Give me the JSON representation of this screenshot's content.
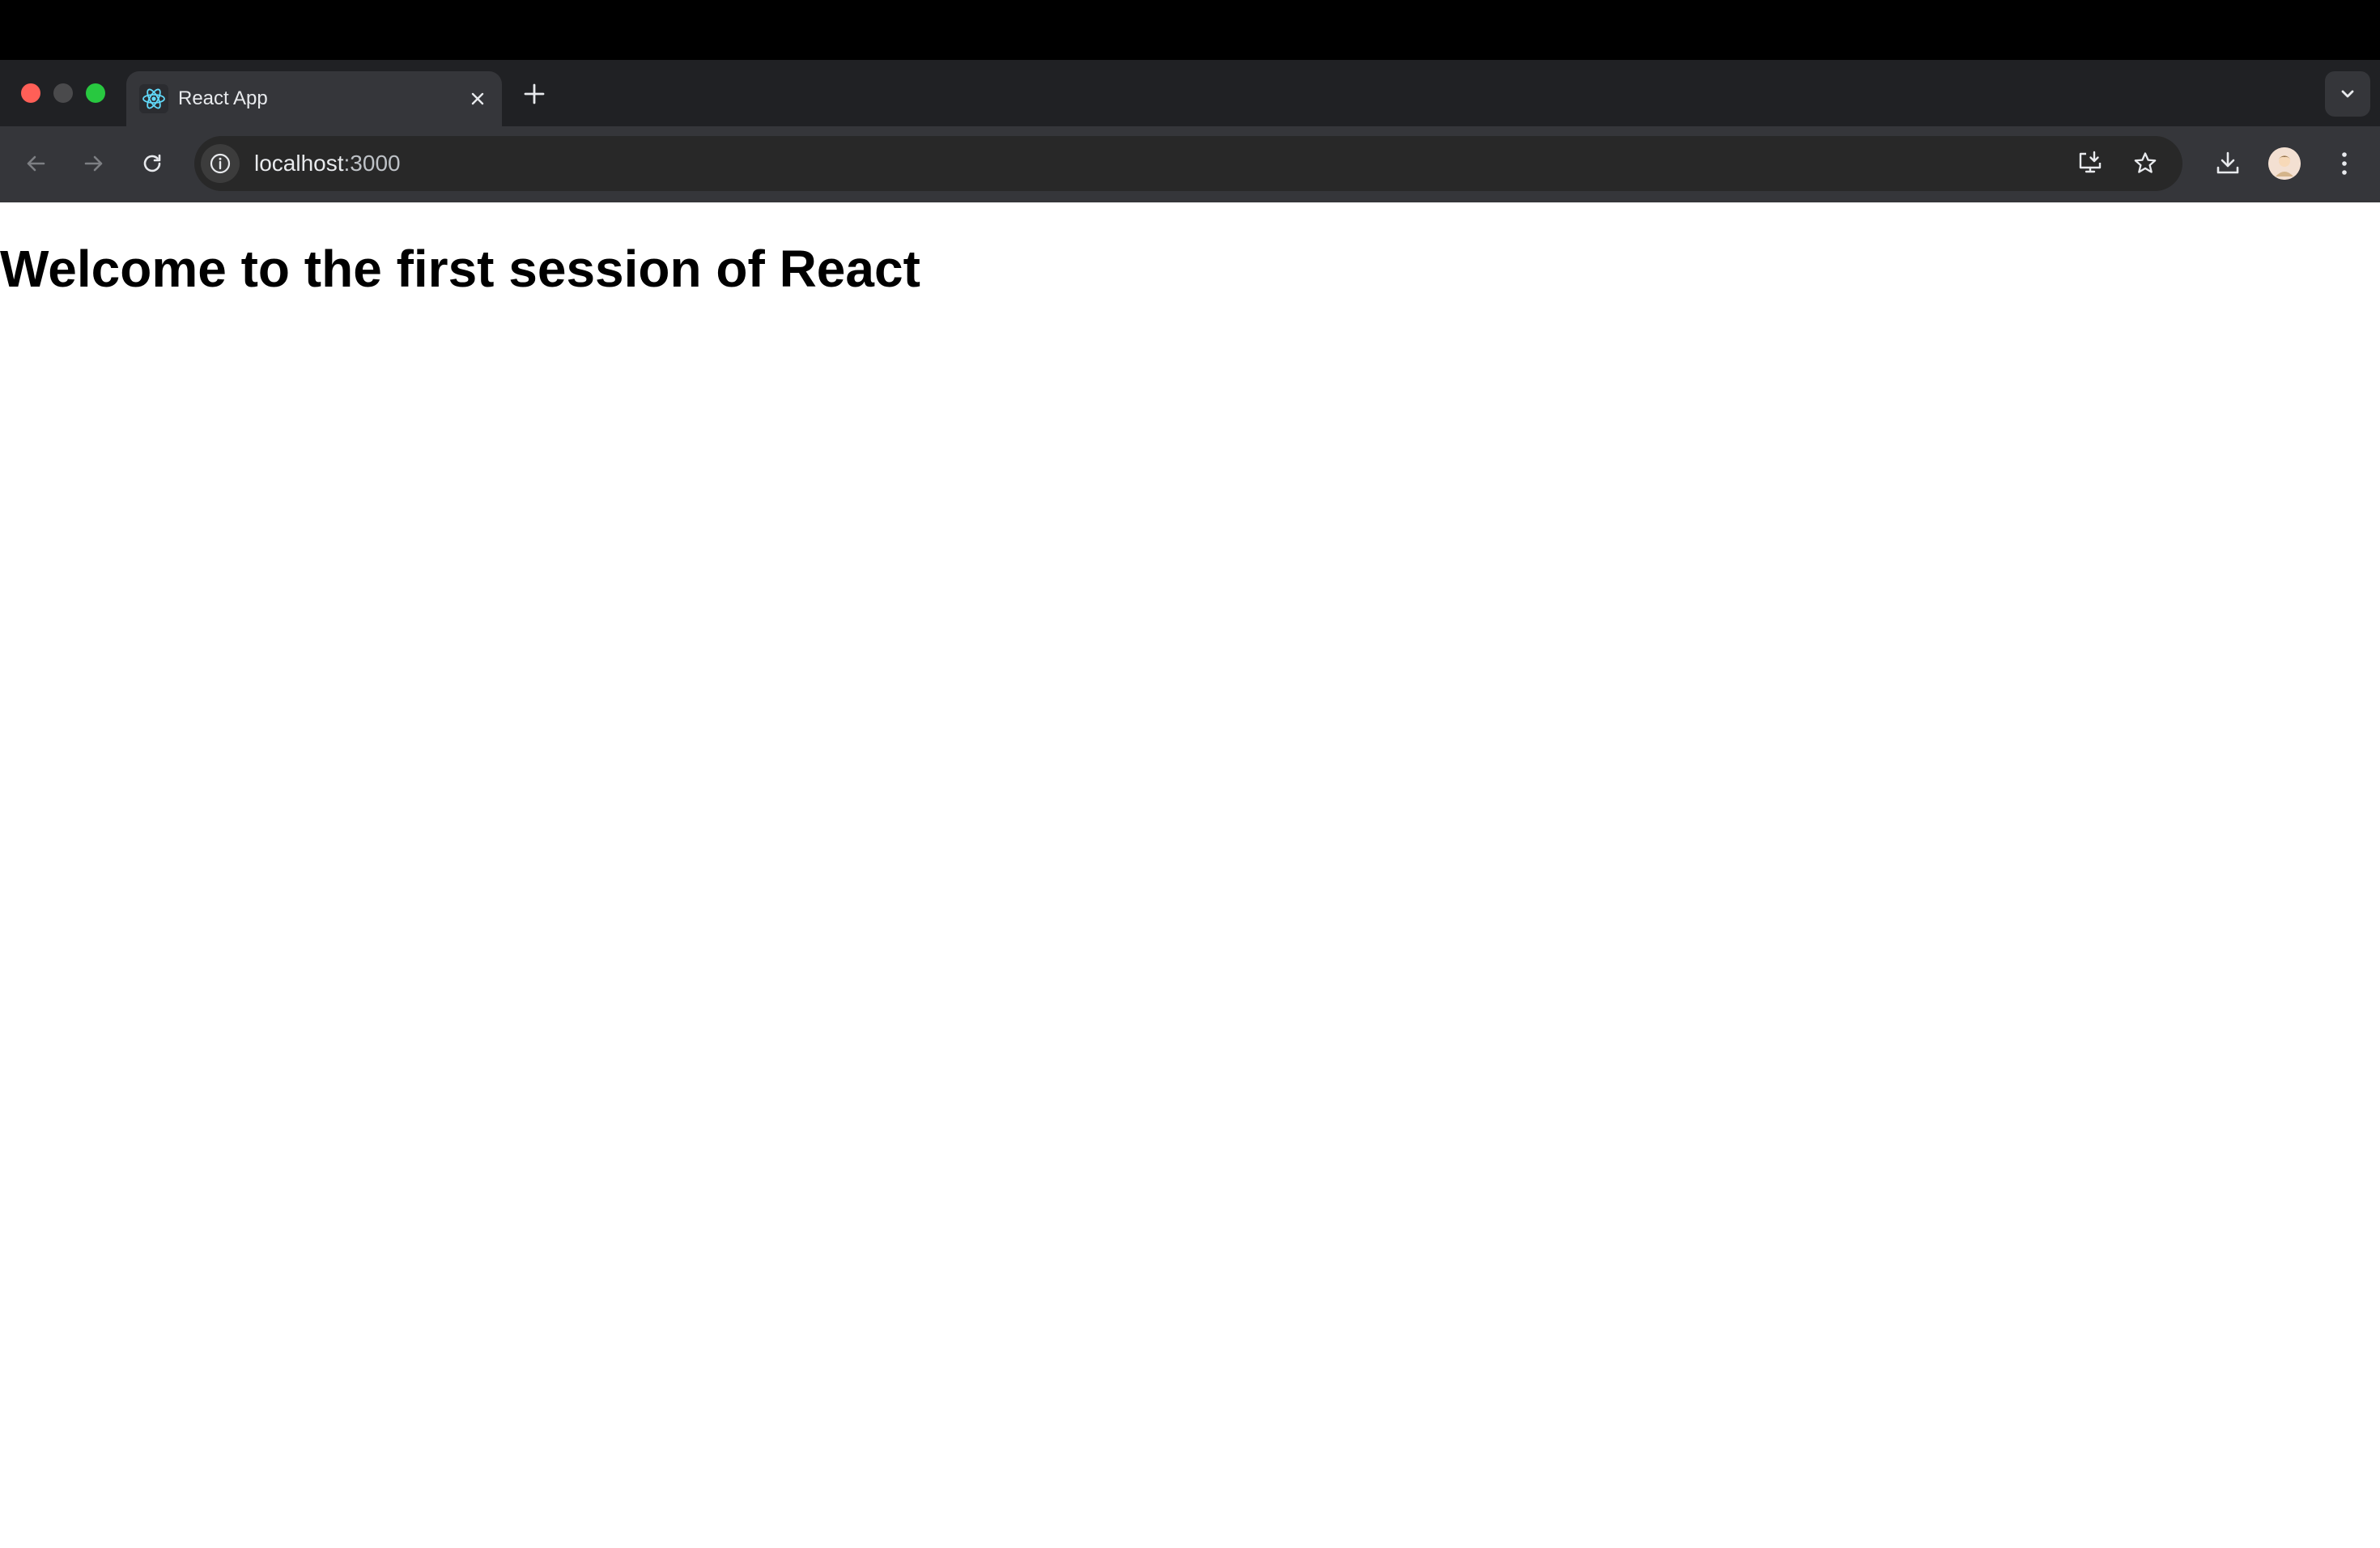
{
  "browser": {
    "tab": {
      "title": "React App",
      "favicon": "react-logo-icon"
    },
    "address_bar": {
      "host": "localhost",
      "port": ":3000"
    },
    "icons": {
      "new_tab": "plus-icon",
      "tab_search": "chevron-down-icon",
      "back": "back-arrow-icon",
      "forward": "forward-arrow-icon",
      "reload": "reload-icon",
      "site_info": "info-icon",
      "install": "install-app-icon",
      "bookmark": "star-icon",
      "downloads": "download-icon",
      "profile": "avatar",
      "menu": "kebab-menu-icon"
    },
    "colors": {
      "traffic_close": "#ff5f57",
      "traffic_min": "#4a4a4c",
      "traffic_max": "#28c840",
      "react_blue": "#61dafb"
    }
  },
  "page": {
    "heading": "Welcome to the first session of React"
  }
}
